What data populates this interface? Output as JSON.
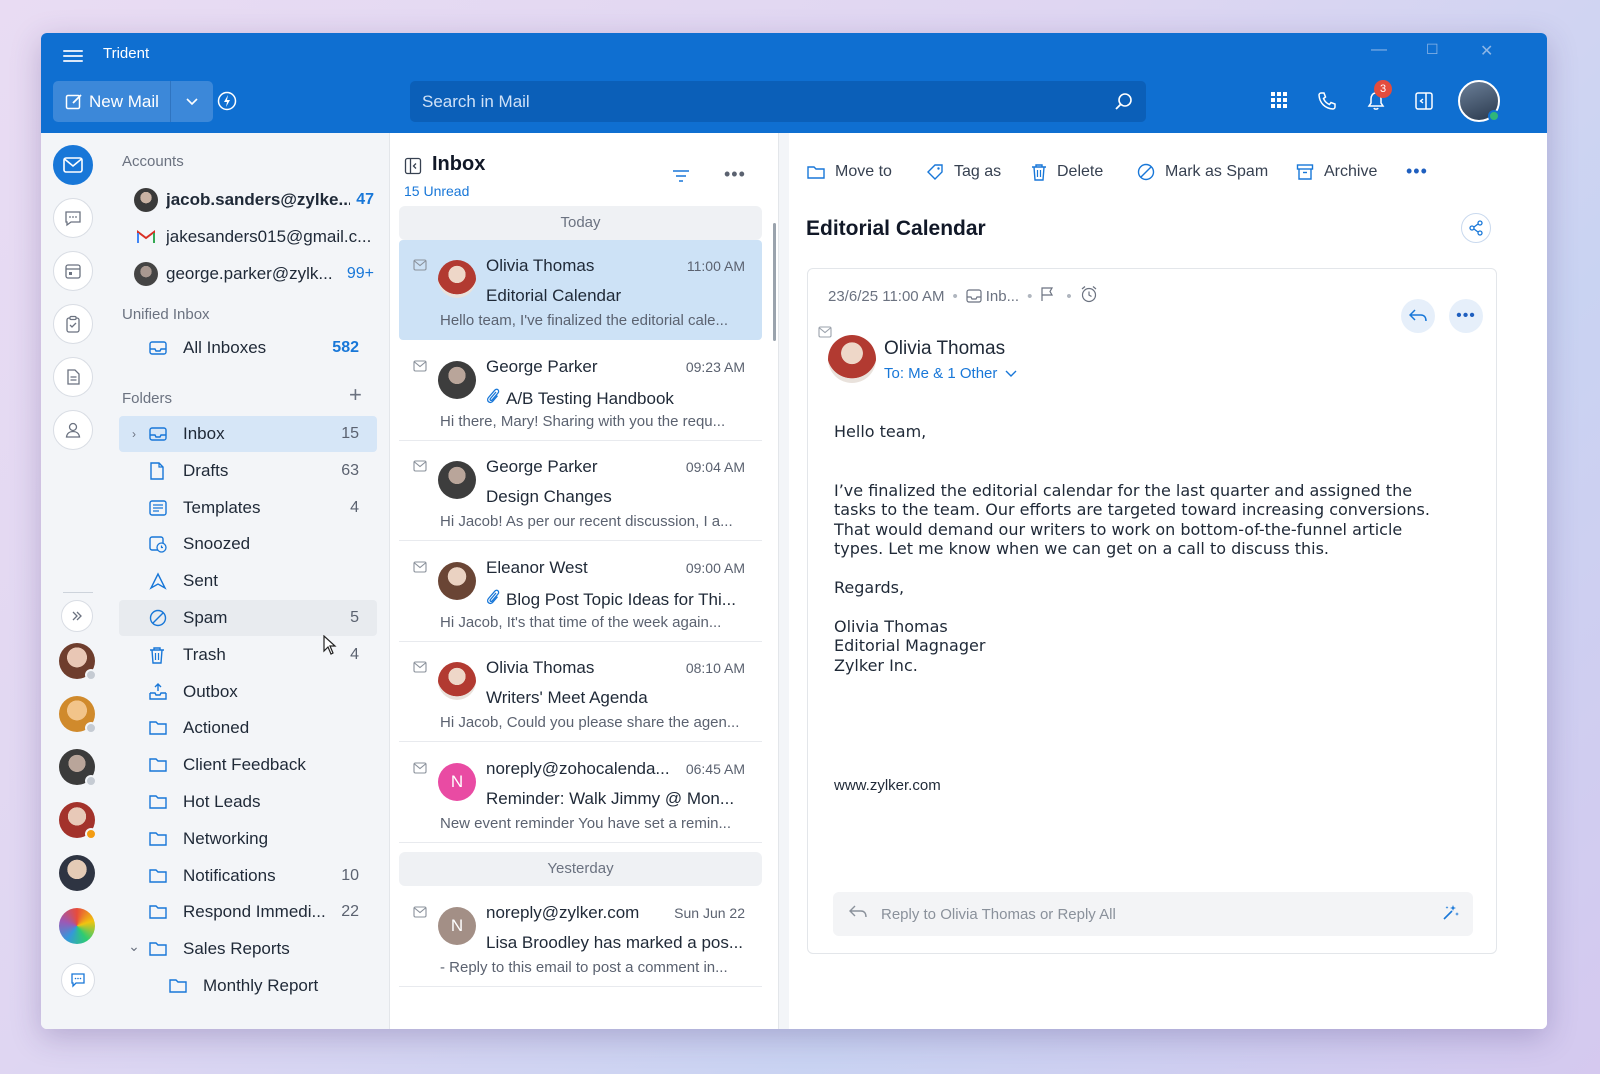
{
  "app": {
    "title": "Trident",
    "new_mail_label": "New Mail",
    "search_placeholder": "Search in Mail",
    "notification_count": "3",
    "accent": "#0f6fd1"
  },
  "accounts": {
    "section_label": "Accounts",
    "items": [
      {
        "name": "jacob.sanders@zylke...",
        "count": "47"
      },
      {
        "name": "jakesanders015@gmail.c...",
        "count": ""
      },
      {
        "name": "george.parker@zylk...",
        "count": "99+"
      }
    ]
  },
  "unified": {
    "section_label": "Unified Inbox",
    "all_inboxes": "All Inboxes",
    "all_count": "582"
  },
  "folders": {
    "section_label": "Folders",
    "items": [
      {
        "label": "Inbox",
        "count": "15",
        "icon": "inbox-icon"
      },
      {
        "label": "Drafts",
        "count": "63",
        "icon": "drafts-icon"
      },
      {
        "label": "Templates",
        "count": "4",
        "icon": "templates-icon"
      },
      {
        "label": "Snoozed",
        "count": "",
        "icon": "snoozed-icon"
      },
      {
        "label": "Sent",
        "count": "",
        "icon": "sent-icon"
      },
      {
        "label": "Spam",
        "count": "5",
        "icon": "spam-icon"
      },
      {
        "label": "Trash",
        "count": "4",
        "icon": "trash-icon"
      },
      {
        "label": "Outbox",
        "count": "",
        "icon": "outbox-icon"
      },
      {
        "label": "Actioned",
        "count": "",
        "icon": "folder-icon"
      },
      {
        "label": "Client Feedback",
        "count": "",
        "icon": "folder-icon"
      },
      {
        "label": "Hot Leads",
        "count": "",
        "icon": "folder-icon"
      },
      {
        "label": "Networking",
        "count": "",
        "icon": "folder-icon"
      },
      {
        "label": "Notifications",
        "count": "10",
        "icon": "folder-icon"
      },
      {
        "label": "Respond Immedi...",
        "count": "22",
        "icon": "folder-icon"
      },
      {
        "label": "Sales Reports",
        "count": "",
        "icon": "folder-icon"
      },
      {
        "label": "Monthly Report",
        "count": "",
        "icon": "folder-icon"
      }
    ]
  },
  "list": {
    "title": "Inbox",
    "unread": "15 Unread",
    "today": "Today",
    "yesterday": "Yesterday",
    "messages": [
      {
        "from": "Olivia Thomas",
        "time": "11:00 AM",
        "subject": "Editorial Calendar",
        "preview": "Hello team, I've finalized the editorial cale...",
        "attach": false
      },
      {
        "from": "George Parker",
        "time": "09:23 AM",
        "subject": "A/B Testing Handbook",
        "preview": "Hi there, Mary! Sharing with you the requ...",
        "attach": true
      },
      {
        "from": "George Parker",
        "time": "09:04 AM",
        "subject": "Design Changes",
        "preview": "Hi Jacob! As per our recent discussion, I a...",
        "attach": false
      },
      {
        "from": "Eleanor West",
        "time": "09:00 AM",
        "subject": "Blog Post Topic Ideas for Thi...",
        "preview": "Hi Jacob, It's that time of the week again...",
        "attach": true
      },
      {
        "from": "Olivia Thomas",
        "time": "08:10 AM",
        "subject": "Writers' Meet Agenda",
        "preview": "Hi Jacob, Could you please share the agen...",
        "attach": false
      },
      {
        "from": "noreply@zohocalenda...",
        "time": "06:45 AM",
        "subject": "Reminder: Walk Jimmy @ Mon...",
        "preview": "New event reminder You have set a remin...",
        "attach": false,
        "initial": "N"
      },
      {
        "from": "noreply@zylker.com",
        "time": "Sun Jun 22",
        "subject": "Lisa Broodley has marked a pos...",
        "preview": "- Reply to this email to post a comment in...",
        "attach": false,
        "initial": "N"
      }
    ]
  },
  "reader": {
    "actions": {
      "move": "Move to",
      "tag": "Tag as",
      "delete": "Delete",
      "spam": "Mark as Spam",
      "archive": "Archive"
    },
    "subject": "Editorial Calendar",
    "date": "23/6/25 11:00 AM",
    "folder": "Inb...",
    "sender": "Olivia Thomas",
    "to": "To: Me & 1 Other",
    "body": {
      "greeting": "Hello team,",
      "paragraph": "I’ve finalized the editorial calendar for the last quarter and assigned the tasks to the team. Our efforts are targeted toward increasing conversions. That would demand our writers to work on bottom-of-the-funnel article types. Let me know when we can get on a call to discuss this.",
      "closing": "Regards,",
      "sig_name": "Olivia Thomas",
      "sig_title": "Editorial Magnager",
      "sig_company": "Zylker Inc."
    },
    "website": "www.zylker.com",
    "reply_placeholder": "Reply to Olivia Thomas or Reply All"
  }
}
